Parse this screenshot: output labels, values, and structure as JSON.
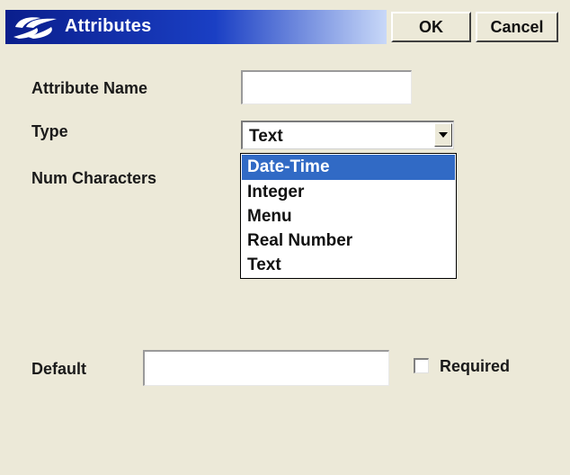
{
  "window": {
    "title": "Attributes",
    "ok_label": "OK",
    "cancel_label": "Cancel",
    "icon": "app-logo-icon"
  },
  "form": {
    "attribute_name_label": "Attribute Name",
    "attribute_name_value": "",
    "type_label": "Type",
    "type_value": "Text",
    "num_characters_label": "Num Characters",
    "default_label": "Default",
    "default_value": "",
    "required_label": "Required",
    "required_checked": false
  },
  "type_dropdown": {
    "expanded": true,
    "options": [
      "Date-Time",
      "Integer",
      "Menu",
      "Real Number",
      "Text"
    ],
    "highlighted": "Date-Time"
  },
  "colors": {
    "titlebar_start": "#0a1e8c",
    "titlebar_end": "#c8d8f8",
    "highlight": "#316ac5",
    "dialog_bg": "#ece9d8"
  }
}
